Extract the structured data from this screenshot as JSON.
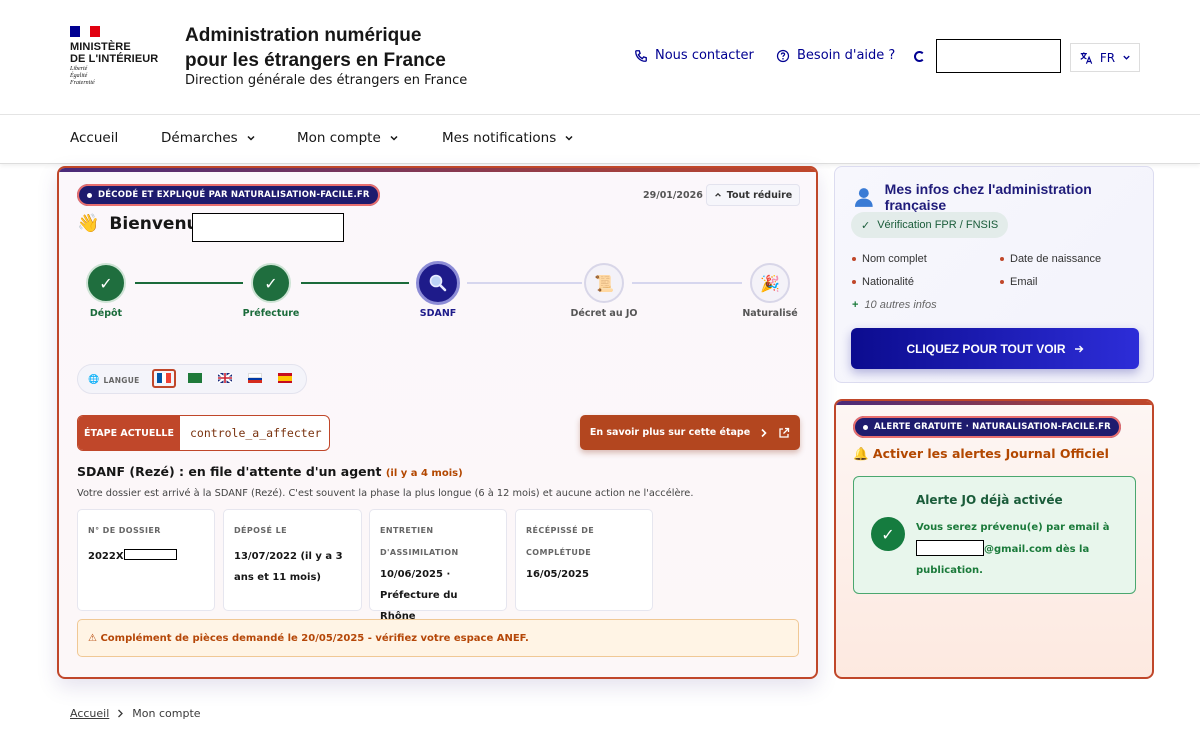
{
  "header": {
    "ministry": [
      "MINISTÈRE",
      "DE L'INTÉRIEUR"
    ],
    "motto": [
      "Liberté",
      "Égalité",
      "Fraternité"
    ],
    "title_line1": "Administration numérique",
    "title_line2": "pour les étrangers en France",
    "subtitle": "Direction générale des étrangers en France",
    "contact": "Nous contacter",
    "help": "Besoin d'aide ?",
    "lang": "FR"
  },
  "nav": {
    "home": "Accueil",
    "demarches": "Démarches",
    "account": "Mon compte",
    "notifications": "Mes notifications"
  },
  "main": {
    "badge": "DÉCODÉ ET EXPLIQUÉ PAR NATURALISATION-FACILE.FR",
    "date": "29/01/2026",
    "reduce": "Tout réduire",
    "welcome": "Bienvenue",
    "steps": [
      {
        "label": "Dépôt",
        "state": "done"
      },
      {
        "label": "Préfecture",
        "state": "done"
      },
      {
        "label": "SDANF",
        "state": "current"
      },
      {
        "label": "Décret au JO",
        "state": "todo"
      },
      {
        "label": "Naturalisé",
        "state": "todo"
      }
    ],
    "lang_label": "LANGUE",
    "etape_label": "ÉTAPE ACTUELLE",
    "etape_value": "controle_a_affecter",
    "savoir": "En savoir plus sur cette étape",
    "status_title": "SDANF (Rezé) : en file d'attente d'un agent",
    "status_ago": "(il y a 4 mois)",
    "status_desc": "Votre dossier est arrivé à la SDANF (Rezé). C'est souvent la phase la plus longue (6 à 12 mois) et aucune action ne l'accélère.",
    "info": [
      {
        "label": "N° DE DOSSIER",
        "value": "2022X"
      },
      {
        "label": "DÉPOSÉ LE",
        "value": "13/07/2022 (il y a 3 ans et 11 mois)"
      },
      {
        "label": "ENTRETIEN D'ASSIMILATION",
        "value": "10/06/2025 · Préfecture du Rhône"
      },
      {
        "label": "RÉCÉPISSÉ DE COMPLÉTUDE",
        "value": "16/05/2025"
      }
    ],
    "warning": "⚠ Complément de pièces demandé le 20/05/2025 - vérifiez votre espace ANEF."
  },
  "infos": {
    "title": "Mes infos chez l'administration française",
    "verif": "Vérification FPR / FNSIS",
    "items": [
      "Nom complet",
      "Date de naissance",
      "Nationalité",
      "Email"
    ],
    "more": "10 autres infos",
    "cta": "CLIQUEZ POUR TOUT VOIR"
  },
  "alert": {
    "badge": "ALERTE GRATUITE · NATURALISATION-FACILE.FR",
    "title": "🔔 Activer les alertes Journal Officiel",
    "box_title": "Alerte JO déjà activée",
    "box_text_1": "Vous serez prévenu(e) par email à",
    "box_text_2": "@gmail.com dès la publication."
  },
  "breadcrumb": {
    "home": "Accueil",
    "current": "Mon compte"
  },
  "colors": {
    "brand_blue": "#000091",
    "accent": "#c0472a",
    "success": "#157c3f"
  }
}
